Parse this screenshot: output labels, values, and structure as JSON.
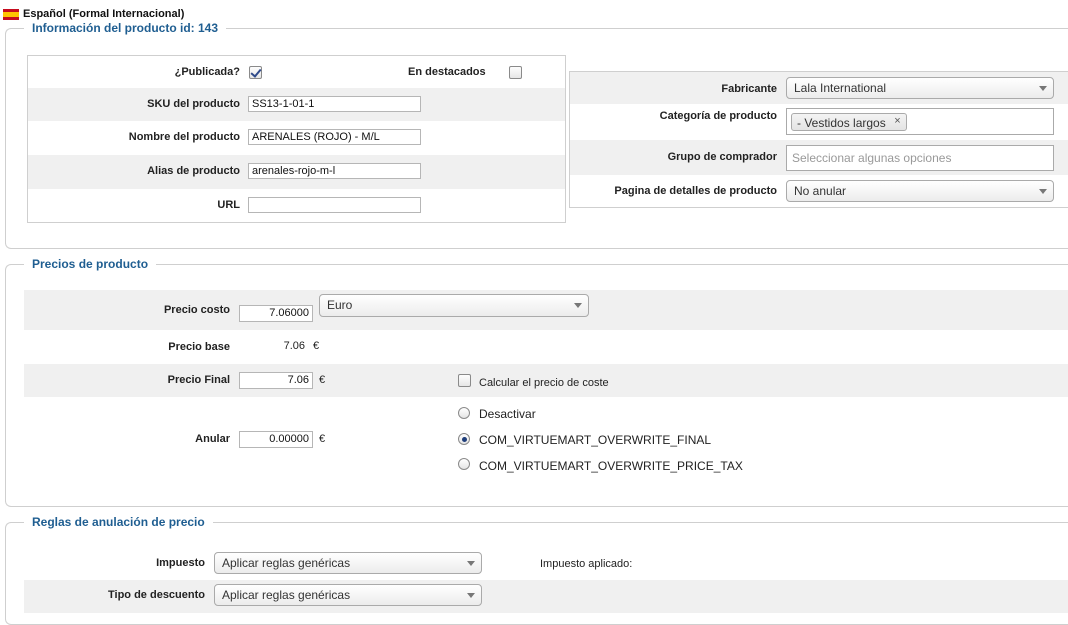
{
  "language": {
    "label": "Español (Formal Internacional)",
    "flag_icon": "spain-flag-icon"
  },
  "product_info": {
    "legend": "Información del producto id: 143",
    "published_label": "¿Publicada?",
    "published_checked": true,
    "featured_label": "En destacados",
    "featured_checked": false,
    "sku_label": "SKU del producto",
    "sku_value": "SS13-1-01-1",
    "name_label": "Nombre del producto",
    "name_value": "ARENALES (ROJO) - M/L",
    "alias_label": "Alias de producto",
    "alias_value": "arenales-rojo-m-l",
    "url_label": "URL",
    "url_value": "",
    "manufacturer_label": "Fabricante",
    "manufacturer_value": "Lala International",
    "category_label": "Categoría de producto",
    "category_tag": "- Vestidos largos",
    "shopper_group_label": "Grupo de comprador",
    "shopper_group_placeholder": "Seleccionar algunas opciones",
    "details_page_label": "Pagina de detalles de producto",
    "details_page_value": "No anular"
  },
  "prices": {
    "legend": "Precios de producto",
    "cost_label": "Precio costo",
    "cost_value": "7.06000",
    "currency_value": "Euro",
    "base_label": "Precio base",
    "base_value": "7.06",
    "final_label": "Precio Final",
    "final_value": "7.06",
    "calc_cost_label": "Calcular el precio de coste",
    "calc_cost_checked": false,
    "override_label": "Anular",
    "override_value": "0.00000",
    "currency_symbol": "€",
    "override_options": [
      {
        "label": "Desactivar",
        "selected": false
      },
      {
        "label": "COM_VIRTUEMART_OVERWRITE_FINAL",
        "selected": true
      },
      {
        "label": "COM_VIRTUEMART_OVERWRITE_PRICE_TAX",
        "selected": false
      }
    ]
  },
  "rules": {
    "legend": "Reglas de anulación de precio",
    "tax_label": "Impuesto",
    "tax_value": "Aplicar reglas genéricas",
    "applied_tax_label": "Impuesto aplicado:",
    "discount_label": "Tipo de descuento",
    "discount_value": "Aplicar reglas genéricas"
  }
}
